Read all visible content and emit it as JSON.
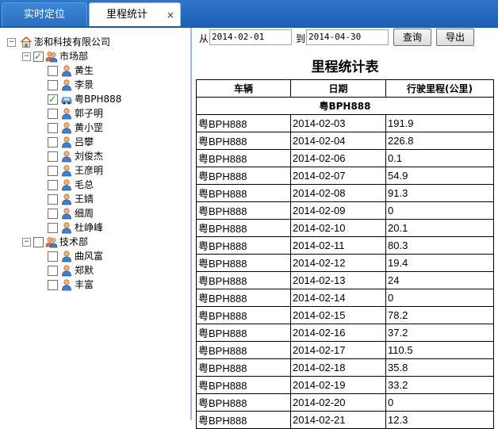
{
  "tabs": [
    {
      "label": "实时定位",
      "active": false
    },
    {
      "label": "里程统计",
      "active": true,
      "close": "×"
    }
  ],
  "tree": {
    "root": "澎和科技有限公司",
    "departments": [
      {
        "name": "市场部",
        "checked": true,
        "members": [
          {
            "name": "黄生",
            "checked": false,
            "type": "person"
          },
          {
            "name": "李景",
            "checked": false,
            "type": "person"
          },
          {
            "name": "粤BPH888",
            "checked": true,
            "type": "car"
          },
          {
            "name": "郭子明",
            "checked": false,
            "type": "person"
          },
          {
            "name": "黄小罡",
            "checked": false,
            "type": "person"
          },
          {
            "name": "吕攀",
            "checked": false,
            "type": "person"
          },
          {
            "name": "刘俊杰",
            "checked": false,
            "type": "person"
          },
          {
            "name": "王彦明",
            "checked": false,
            "type": "person"
          },
          {
            "name": "毛总",
            "checked": false,
            "type": "person"
          },
          {
            "name": "王婧",
            "checked": false,
            "type": "person"
          },
          {
            "name": "细周",
            "checked": false,
            "type": "person"
          },
          {
            "name": "杜峥峰",
            "checked": false,
            "type": "person"
          }
        ]
      },
      {
        "name": "技术部",
        "checked": false,
        "members": [
          {
            "name": "曲风富",
            "checked": false,
            "type": "person"
          },
          {
            "name": "郑默",
            "checked": false,
            "type": "person"
          },
          {
            "name": "丰富",
            "checked": false,
            "type": "person"
          }
        ]
      }
    ]
  },
  "toolbar": {
    "from_label": "从",
    "from_date": "2014-02-01",
    "to_label": "到",
    "to_date": "2014-04-30",
    "query_button": "查询",
    "export_button": "导出"
  },
  "report": {
    "title": "里程统计表",
    "columns": [
      "车辆",
      "日期",
      "行驶里程(公里)"
    ],
    "group": "粤BPH888",
    "rows": [
      [
        "粤BPH888",
        "2014-02-03",
        "191.9"
      ],
      [
        "粤BPH888",
        "2014-02-04",
        "226.8"
      ],
      [
        "粤BPH888",
        "2014-02-06",
        "0.1"
      ],
      [
        "粤BPH888",
        "2014-02-07",
        "54.9"
      ],
      [
        "粤BPH888",
        "2014-02-08",
        "91.3"
      ],
      [
        "粤BPH888",
        "2014-02-09",
        "0"
      ],
      [
        "粤BPH888",
        "2014-02-10",
        "20.1"
      ],
      [
        "粤BPH888",
        "2014-02-11",
        "80.3"
      ],
      [
        "粤BPH888",
        "2014-02-12",
        "19.4"
      ],
      [
        "粤BPH888",
        "2014-02-13",
        "24"
      ],
      [
        "粤BPH888",
        "2014-02-14",
        "0"
      ],
      [
        "粤BPH888",
        "2014-02-15",
        "78.2"
      ],
      [
        "粤BPH888",
        "2014-02-16",
        "37.2"
      ],
      [
        "粤BPH888",
        "2014-02-17",
        "110.5"
      ],
      [
        "粤BPH888",
        "2014-02-18",
        "35.8"
      ],
      [
        "粤BPH888",
        "2014-02-19",
        "33.2"
      ],
      [
        "粤BPH888",
        "2014-02-20",
        "0"
      ],
      [
        "粤BPH888",
        "2014-02-21",
        "12.3"
      ]
    ]
  }
}
